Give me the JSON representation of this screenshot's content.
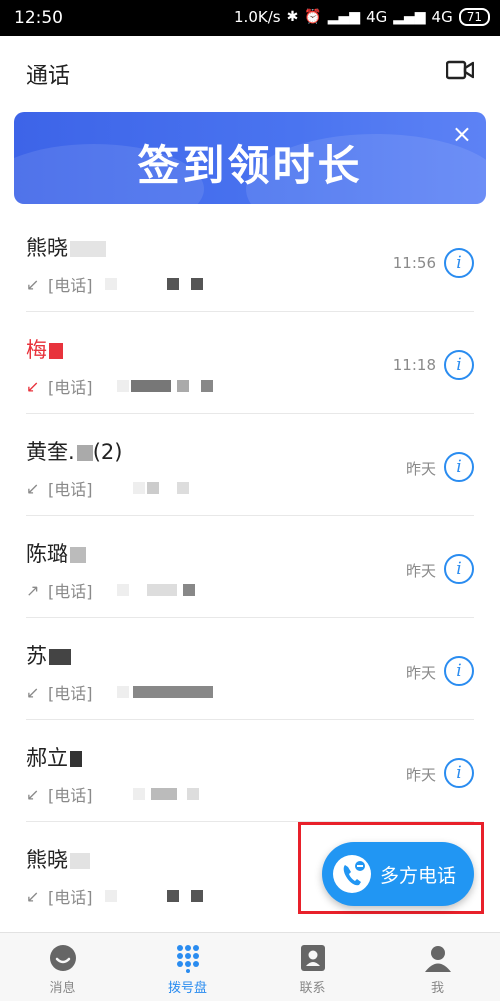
{
  "status_bar": {
    "time": "12:50",
    "network_speed": "1.0K/s",
    "signal1": "4G",
    "signal2": "4G",
    "battery": "71"
  },
  "header": {
    "title": "通话"
  },
  "banner": {
    "text": "签到领时长",
    "close": "×"
  },
  "calls": [
    {
      "name": "熊晓",
      "type": "[电话]",
      "time": "11:56",
      "direction": "incoming",
      "missed": false
    },
    {
      "name": "梅",
      "type": "[电话]",
      "time": "11:18",
      "direction": "incoming",
      "missed": true
    },
    {
      "name": "黄奎.",
      "name_suffix": "(2)",
      "type": "[电话]",
      "time": "昨天",
      "direction": "incoming",
      "missed": false
    },
    {
      "name": "陈璐",
      "type": "[电话]",
      "time": "昨天",
      "direction": "outgoing",
      "missed": false
    },
    {
      "name": "苏",
      "type": "[电话]",
      "time": "昨天",
      "direction": "incoming",
      "missed": false
    },
    {
      "name": "郝立",
      "type": "[电话]",
      "time": "昨天",
      "direction": "incoming",
      "missed": false
    },
    {
      "name": "熊晓",
      "type": "[电话]",
      "time": "",
      "direction": "incoming",
      "missed": false
    }
  ],
  "fab": {
    "label": "多方电话"
  },
  "tabs": [
    {
      "label": "消息"
    },
    {
      "label": "拨号盘",
      "active": true
    },
    {
      "label": "联系"
    },
    {
      "label": "我"
    }
  ],
  "colors": {
    "accent": "#2a8cf0",
    "missed": "#e8333c",
    "banner": "#4a74f0",
    "highlight_box": "#e8202a"
  }
}
